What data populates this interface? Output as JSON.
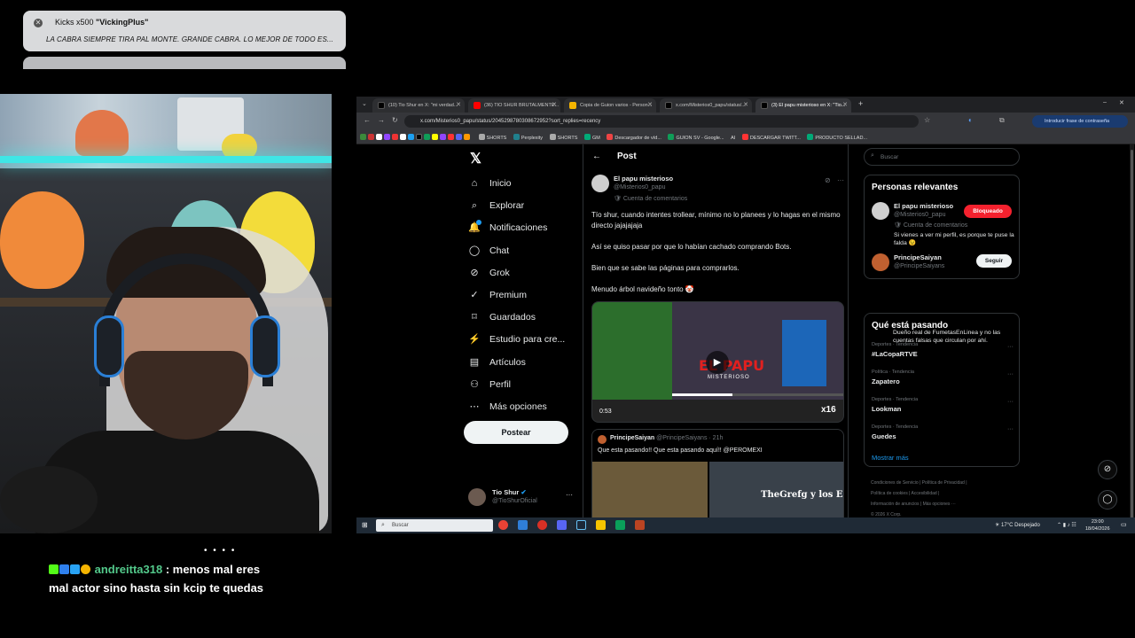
{
  "kick_alert": {
    "title_prefix": "Kicks x500 ",
    "title_user": "\"VickingPlus\"",
    "message": "LA CABRA SIEMPRE TIRA PAL MONTE. GRANDE CABRA. LO MEJOR DE TODO ES..."
  },
  "chat": {
    "username": "andreitta318",
    "message_part1": " : menos mal eres",
    "message_part2": "mal actor sino hasta sin kcip te quedas",
    "dots": "• • • •"
  },
  "browser": {
    "tabs": [
      {
        "label": "(10) Tio Shur en X: \"mi verdad...",
        "color": "#000"
      },
      {
        "label": "(36) TIO SHUR BRUTALMENTE...",
        "color": "#ff0000"
      },
      {
        "label": "Copia de Guion varios - Person...",
        "color": "#f4b400"
      },
      {
        "label": "x.com/Misterios0_papu/status/...",
        "color": "#000"
      },
      {
        "label": "(3) El papu misterioso en X: \"Tio...",
        "color": "#000"
      }
    ],
    "url": "x.com/Misterios0_papu/status/2045298780308672952?sort_replies=recency",
    "password_button": "Introducir frase de contraseña",
    "bookmarks": [
      "SHORTS",
      "Perplexity",
      "SHORTS",
      "GM",
      "Descargador de víd...",
      "GUION SV - Google...",
      "AI",
      "DESCARGAR TWITT...",
      "PRODUCTO SELLAD..."
    ]
  },
  "nav": {
    "items": [
      {
        "label": "Inicio",
        "icon": "home-icon",
        "glyph": "⌂"
      },
      {
        "label": "Explorar",
        "icon": "search-icon",
        "glyph": "⌕"
      },
      {
        "label": "Notificaciones",
        "icon": "bell-icon",
        "glyph": "🔔"
      },
      {
        "label": "Chat",
        "icon": "chat-icon",
        "glyph": "◯"
      },
      {
        "label": "Grok",
        "icon": "grok-icon",
        "glyph": "⊘"
      },
      {
        "label": "Premium",
        "icon": "premium-icon",
        "glyph": "✓"
      },
      {
        "label": "Guardados",
        "icon": "bookmark-icon",
        "glyph": "⌑"
      },
      {
        "label": "Estudio para cre...",
        "icon": "studio-icon",
        "glyph": "⚡"
      },
      {
        "label": "Artículos",
        "icon": "articles-icon",
        "glyph": "▤"
      },
      {
        "label": "Perfil",
        "icon": "profile-icon",
        "glyph": "⚇"
      },
      {
        "label": "Más opciones",
        "icon": "more-icon",
        "glyph": "⋯"
      }
    ],
    "post_button": "Postear",
    "me": {
      "name": "Tio Shur",
      "handle": "@TioShurOficial"
    }
  },
  "post": {
    "header": "Post",
    "author_name": "El papu misterioso",
    "author_handle": "@Misterios0_papu",
    "author_tag": "Cuenta de comentarios",
    "paragraphs": [
      "Tío shur, cuando intentes trollear, mínimo no lo planees y lo hagas en el mismo directo jajajajaja",
      "Así se quiso pasar por que lo habían cachado comprando Bots.",
      "Bien que se sabe las páginas para comprarlos.",
      "Menudo árbol navideño tonto 🤡"
    ],
    "video_time": "0:53",
    "video_badge": "x16",
    "video_title": "EL PAPU",
    "video_subtitle": "MISTERIOSO",
    "quote": {
      "name": "PrincipeSaiyan",
      "handle": "@PrincipeSaiyans · 21h",
      "text": "Que esta pasando!! Que esta pasando aquí!! @PEROMEXI",
      "thumb_text": "TheGrefg y los Es"
    }
  },
  "right": {
    "search_placeholder": "Buscar",
    "relevant_title": "Personas relevantes",
    "people": [
      {
        "name": "El papu misterioso",
        "handle": "@Misterios0_papu",
        "tag": "Cuenta de comentarios",
        "bio": "Si vienes a ver mi perfil, es porque te puse la falda 😉",
        "button": "Bloqueado"
      },
      {
        "name": "PrincipeSaiyan",
        "handle": "@PrincipeSaiyans",
        "bio": "Dueño real de FumetasEnLinea y no las cuentas falsas que circulan por ahí.",
        "button": "Seguir"
      }
    ],
    "trends_title": "Qué está pasando",
    "trends": [
      {
        "cat": "Deportes · Tendencia",
        "name": "#LaCopaRTVE"
      },
      {
        "cat": "Política · Tendencia",
        "name": "Zapatero"
      },
      {
        "cat": "Deportes · Tendencia",
        "name": "Lookman"
      },
      {
        "cat": "Deportes · Tendencia",
        "name": "Guedes"
      }
    ],
    "show_more": "Mostrar más",
    "footer": [
      "Condiciones de Servicio",
      "Política de Privacidad",
      "Política de cookies",
      "Accesibilidad",
      "Información de anuncios",
      "Más opciones ···",
      "© 2026 X Corp."
    ]
  },
  "taskbar": {
    "search_placeholder": "Buscar",
    "weather": "17°C  Despejado",
    "time": "23:00",
    "date": "18/04/2026"
  },
  "colors": {
    "x_blue": "#1d9bf0",
    "blocked_red": "#f4212e",
    "chat_user": "#53c98b"
  }
}
